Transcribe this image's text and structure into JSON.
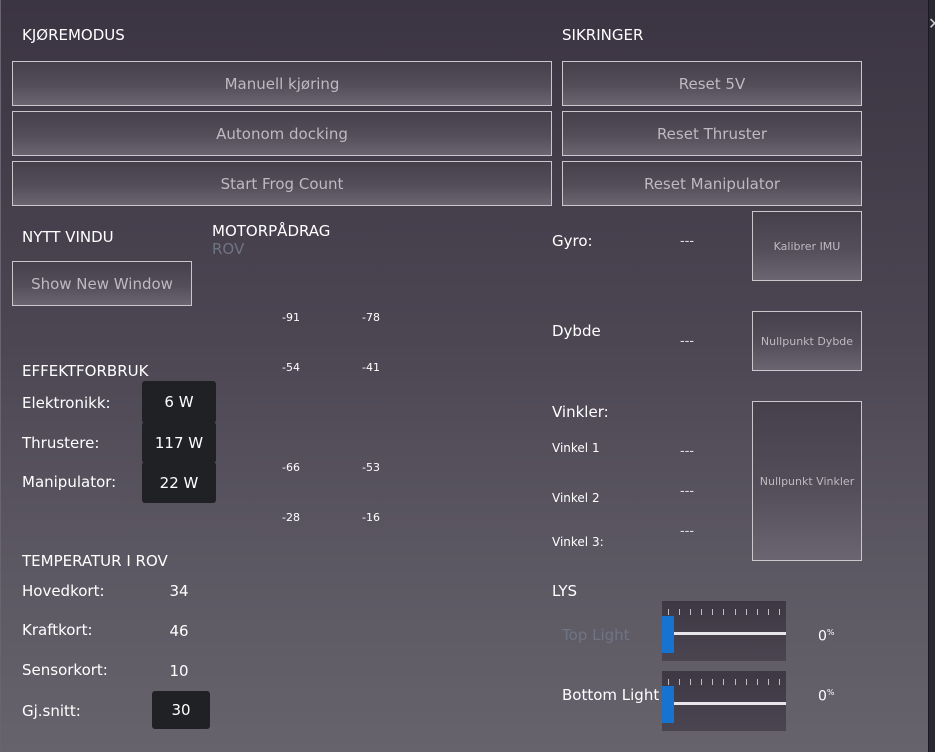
{
  "kjoremodus": {
    "title": "KJØREMODUS",
    "buttons": [
      "Manuell kjøring",
      "Autonom docking",
      "Start Frog Count"
    ]
  },
  "sikringer": {
    "title": "SIKRINGER",
    "buttons": [
      "Reset 5V",
      "Reset Thruster",
      "Reset Manipulator"
    ]
  },
  "nytt_vindu": {
    "title": "NYTT VINDU",
    "button": "Show New Window"
  },
  "motor": {
    "title": "MOTORPÅDRAG",
    "subtitle": "ROV",
    "values": [
      "-91",
      "-78",
      "-54",
      "-41",
      "-66",
      "-53",
      "-28",
      "-16"
    ]
  },
  "effekt": {
    "title": "EFFEKTFORBRUK",
    "rows": [
      {
        "label": "Elektronikk:",
        "value": "6 W"
      },
      {
        "label": "Thrustere:",
        "value": "117 W"
      },
      {
        "label": "Manipulator:",
        "value": "22 W"
      }
    ]
  },
  "temperatur": {
    "title": "TEMPERATUR I ROV",
    "rows": [
      {
        "label": "Hovedkort:",
        "value": "34"
      },
      {
        "label": "Kraftkort:",
        "value": "46"
      },
      {
        "label": "Sensorkort:",
        "value": "10"
      },
      {
        "label": "Gj.snitt:",
        "value": "30"
      }
    ]
  },
  "sensors": {
    "gyro_label": "Gyro:",
    "gyro_value": "---",
    "gyro_button": "Kalibrer IMU",
    "dybde_label": "Dybde",
    "dybde_value": "---",
    "dybde_button": "Nullpunkt Dybde",
    "vinkler_label": "Vinkler:",
    "vinkler": [
      {
        "label": "Vinkel 1",
        "value": "---"
      },
      {
        "label": "Vinkel 2",
        "value": "---"
      },
      {
        "label": "Vinkel 3:",
        "value": "---"
      }
    ],
    "vinkler_button": "Nullpunkt Vinkler"
  },
  "lys": {
    "title": "LYS",
    "lights": [
      {
        "label": "Top Light",
        "percent": "0",
        "unit": "%",
        "level": 0,
        "label_color": "#6f7485"
      },
      {
        "label": "Bottom Light",
        "percent": "0",
        "unit": "%",
        "level": 0,
        "label_color": "#ffffff"
      }
    ]
  },
  "colors": {
    "accent": "#1674d0",
    "value_box": "#202125",
    "muted_label": "#6f7485"
  }
}
